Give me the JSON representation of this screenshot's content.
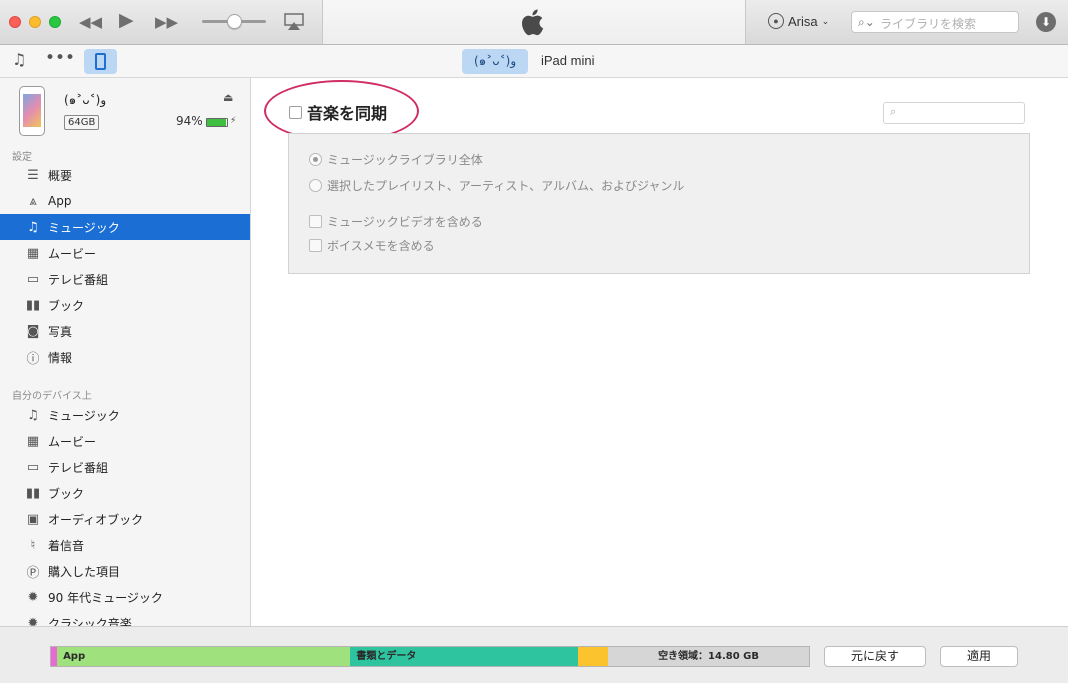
{
  "window": {
    "title_logo": "apple-logo",
    "account": {
      "name": "Arisa"
    },
    "library_search": {
      "placeholder": "ライブラリを検索"
    }
  },
  "toolbar": {
    "device_chip": "(๑˃ᴗ˂)ﻭ",
    "device_model": "iPad mini"
  },
  "device": {
    "name": "(๑˃ᴗ˂)ﻭ",
    "capacity": "64GB",
    "battery": "94%",
    "battery_level": 0.94
  },
  "sidebar": {
    "settings_header": "設定",
    "settings_items": [
      {
        "label": "概要",
        "icon": "summary-icon"
      },
      {
        "label": "App",
        "icon": "app-store-icon"
      },
      {
        "label": "ミュージック",
        "icon": "music-note-icon",
        "selected": true
      },
      {
        "label": "ムービー",
        "icon": "film-icon"
      },
      {
        "label": "テレビ番組",
        "icon": "tv-icon"
      },
      {
        "label": "ブック",
        "icon": "book-icon"
      },
      {
        "label": "写真",
        "icon": "camera-icon"
      },
      {
        "label": "情報",
        "icon": "info-icon"
      }
    ],
    "on_device_header": "自分のデバイス上",
    "on_device_items": [
      {
        "label": "ミュージック",
        "icon": "music-note-icon"
      },
      {
        "label": "ムービー",
        "icon": "film-icon"
      },
      {
        "label": "テレビ番組",
        "icon": "tv-icon"
      },
      {
        "label": "ブック",
        "icon": "book-icon"
      },
      {
        "label": "オーディオブック",
        "icon": "audiobook-icon"
      },
      {
        "label": "着信音",
        "icon": "bell-icon"
      },
      {
        "label": "購入した項目",
        "icon": "purchased-icon"
      },
      {
        "label": "90 年代ミュージック",
        "icon": "gear-icon"
      },
      {
        "label": "クラシック音楽",
        "icon": "gear-icon"
      }
    ]
  },
  "main": {
    "sync_label": "音楽を同期",
    "sync_checked": false,
    "options": {
      "entire_library": "ミュージックライブラリ全体",
      "selected_items": "選択したプレイリスト、アーティスト、アルバム、およびジャンル",
      "include_videos": "ミュージックビデオを含める",
      "include_voice_memos": "ボイスメモを含める"
    }
  },
  "capacity_bar": {
    "segments": [
      {
        "label": "",
        "color": "#e86bd3",
        "fraction": 0.008
      },
      {
        "label": "App",
        "color": "#9fe27d",
        "fraction": 0.387
      },
      {
        "label": "書類とデータ",
        "color": "#2ec4a0",
        "fraction": 0.3
      },
      {
        "label": "",
        "color": "#fbc42e",
        "fraction": 0.04
      },
      {
        "label": "空き領域：14.80 GB",
        "color": "#d6d6d6",
        "fraction": 0.265
      }
    ]
  },
  "buttons": {
    "revert": "元に戻す",
    "apply": "適用"
  }
}
